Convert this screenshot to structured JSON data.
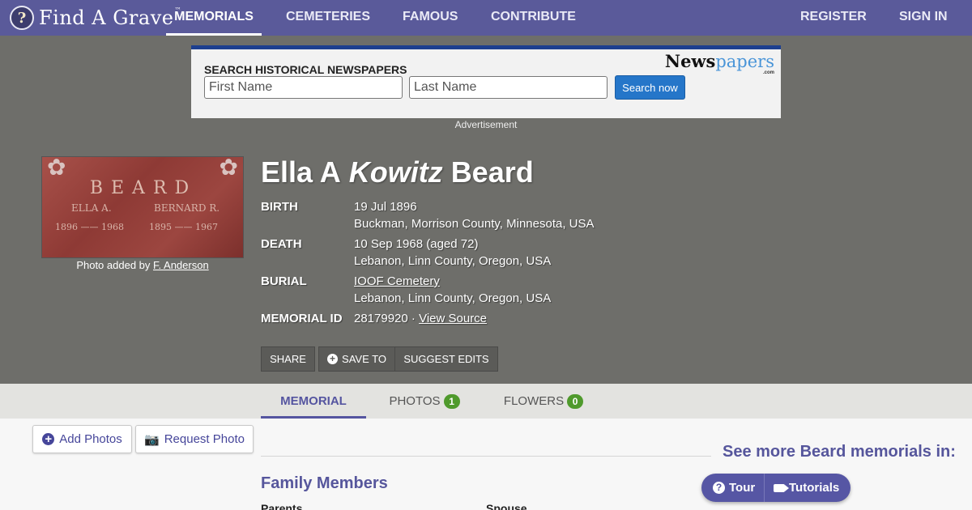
{
  "nav": {
    "logo_text": "Find A Grave",
    "logo_tm": "™",
    "items": [
      {
        "label": "MEMORIALS",
        "active": true
      },
      {
        "label": "CEMETERIES",
        "active": false
      },
      {
        "label": "FAMOUS",
        "active": false
      },
      {
        "label": "CONTRIBUTE",
        "active": false
      }
    ],
    "register_label": "REGISTER",
    "signin_label": "SIGN IN"
  },
  "ad": {
    "heading": "SEARCH HISTORICAL NEWSPAPERS",
    "first_placeholder": "First Name",
    "last_placeholder": "Last Name",
    "button_label": "Search now",
    "brand_bold": "News",
    "brand_rest": "papers",
    "brand_suffix": ".com",
    "caption": "Advertisement"
  },
  "photo": {
    "caption_prefix": "Photo added by",
    "author": "F. Anderson",
    "stone_text": {
      "family": "BEARD",
      "left_name": "ELLA A.",
      "right_name": "BERNARD R.",
      "left_dates": "1896 —— 1968",
      "right_dates": "1895 —— 1967"
    }
  },
  "person": {
    "first": "Ella A",
    "maiden": "Kowitz",
    "last": "Beard"
  },
  "facts": {
    "birth_label": "BIRTH",
    "birth_date": "19 Jul 1896",
    "birth_place": "Buckman, Morrison County, Minnesota, USA",
    "death_label": "DEATH",
    "death_date": "10 Sep 1968 (aged 72)",
    "death_place": "Lebanon, Linn County, Oregon, USA",
    "burial_label": "BURIAL",
    "burial_cemetery": "IOOF Cemetery",
    "burial_place": "Lebanon, Linn County, Oregon, USA",
    "memorial_label": "MEMORIAL ID",
    "memorial_id": "28179920",
    "memorial_sep": "·",
    "view_source": "View Source"
  },
  "actions": {
    "share": "SHARE",
    "save_to": "SAVE TO",
    "suggest_edits": "SUGGEST EDITS"
  },
  "tabs": [
    {
      "label": "MEMORIAL",
      "count": null,
      "active": true
    },
    {
      "label": "PHOTOS",
      "count": "1",
      "active": false
    },
    {
      "label": "FLOWERS",
      "count": "0",
      "active": false
    }
  ],
  "content": {
    "add_photos": "Add Photos",
    "request_photo": "Request Photo",
    "family_heading": "Family Members",
    "parents_label": "Parents",
    "spouse_label": "Spouse",
    "see_more": "See more Beard memorials in:"
  },
  "help": {
    "tour": "Tour",
    "tutorials": "Tutorials"
  },
  "colors": {
    "nav_bg": "#5a5a9a",
    "hero_bg": "#6e6e6a",
    "accent": "#56569c",
    "badge": "#4f9a2c",
    "ad_button": "#2576c9"
  }
}
